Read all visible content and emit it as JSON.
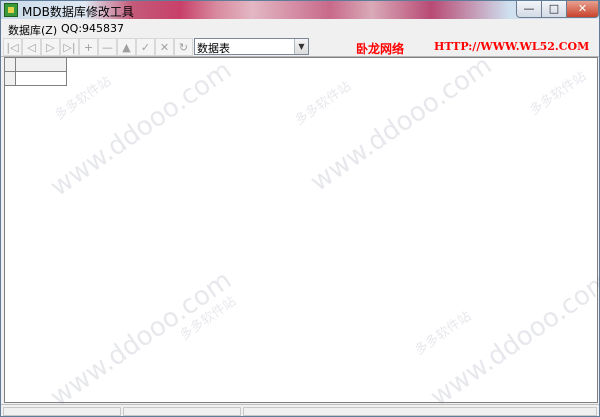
{
  "window": {
    "title": "MDB数据库修改工具",
    "caption_buttons": {
      "minimize": "—",
      "maximize": "□",
      "close": "✕"
    }
  },
  "menu": {
    "database": "数据库(Z)",
    "qq": "QQ:945837"
  },
  "toolbar": {
    "buttons": [
      {
        "icon": "first-record-icon",
        "glyph": "|◁"
      },
      {
        "icon": "prior-record-icon",
        "glyph": "◁"
      },
      {
        "icon": "next-record-icon",
        "glyph": "▷"
      },
      {
        "icon": "last-record-icon",
        "glyph": "▷|"
      },
      {
        "icon": "insert-record-icon",
        "glyph": "+"
      },
      {
        "icon": "delete-record-icon",
        "glyph": "—"
      },
      {
        "icon": "edit-record-icon",
        "glyph": "▲"
      },
      {
        "icon": "post-edit-icon",
        "glyph": "✓"
      },
      {
        "icon": "cancel-edit-icon",
        "glyph": "✕"
      },
      {
        "icon": "refresh-data-icon",
        "glyph": "↻"
      }
    ],
    "table_select": {
      "value": "数据表"
    },
    "brand_name": "卧龙网络",
    "brand_url": "HTTP://WWW.WL52.COM"
  },
  "watermarks": {
    "url": "www.ddooo.com",
    "cn": "多多软件站"
  },
  "colors": {
    "brand_text": "#ff0000",
    "window_bg": "#f0f0f0",
    "grid_bg": "#ffffff"
  }
}
